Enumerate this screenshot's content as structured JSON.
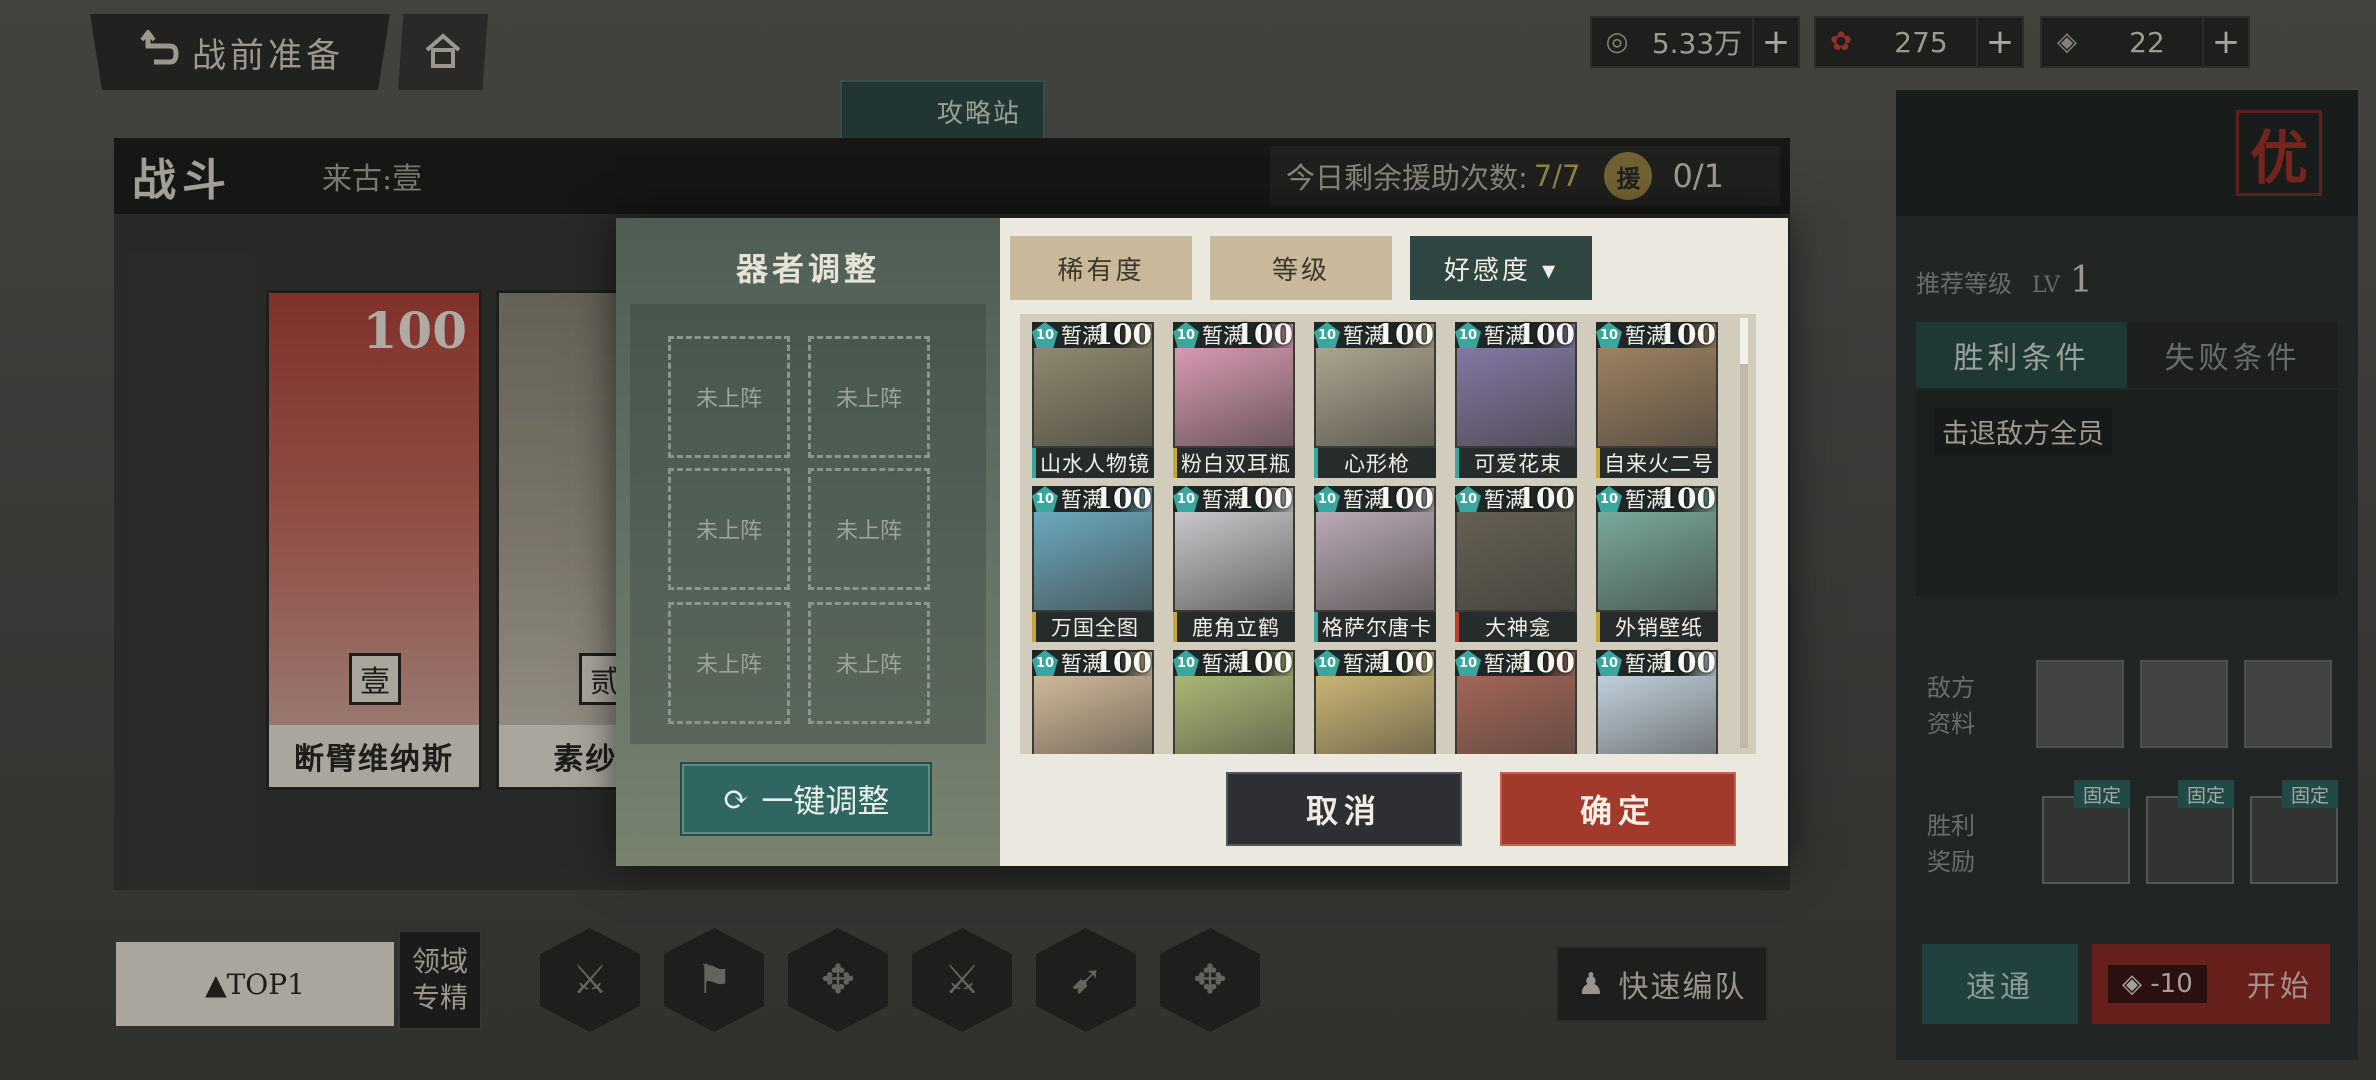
{
  "topbar": {
    "back_label": "战前准备",
    "resources": [
      {
        "icon": "coin-icon",
        "value": "5.33万"
      },
      {
        "icon": "gem-icon",
        "value": "275"
      },
      {
        "icon": "stamina-icon",
        "value": "22"
      }
    ],
    "guide_label": "攻略站"
  },
  "battle": {
    "title": "战斗",
    "stage": "来古:壹",
    "assist_label": "今日剩余援助次数:",
    "assist_count": "7/7",
    "assist_icon_char": "援",
    "assist_ratio": "0/1",
    "cards": [
      {
        "name": "断臂维纳斯",
        "level": "100",
        "seal": "壹"
      },
      {
        "name": "素纱...",
        "level": "",
        "seal": "贰"
      }
    ]
  },
  "modal": {
    "title": "器者调整",
    "empty_slot_label": "未上阵",
    "slots": [
      "未上阵",
      "未上阵",
      "未上阵",
      "未上阵",
      "未上阵",
      "未上阵"
    ],
    "adjust_button": "一键调整",
    "sort_buttons": [
      {
        "label": "稀有度",
        "active": false
      },
      {
        "label": "等级",
        "active": false
      },
      {
        "label": "好感度 ▾",
        "active": true
      }
    ],
    "items": [
      {
        "name": "山水人物镜",
        "star": "10",
        "status": "暂满",
        "level": "100"
      },
      {
        "name": "粉白双耳瓶",
        "star": "10",
        "status": "暂满",
        "level": "100"
      },
      {
        "name": "心形枪",
        "star": "10",
        "status": "暂满",
        "level": "100"
      },
      {
        "name": "可爱花束",
        "star": "10",
        "status": "暂满",
        "level": "100"
      },
      {
        "name": "自来火二号",
        "star": "10",
        "status": "暂满",
        "level": "100"
      },
      {
        "name": "万国全图",
        "star": "10",
        "status": "暂满",
        "level": "100"
      },
      {
        "name": "鹿角立鹤",
        "star": "10",
        "status": "暂满",
        "level": "100"
      },
      {
        "name": "格萨尔唐卡",
        "star": "10",
        "status": "暂满",
        "level": "100"
      },
      {
        "name": "大神龛",
        "star": "10",
        "status": "暂满",
        "level": "100"
      },
      {
        "name": "外销壁纸",
        "star": "10",
        "status": "暂满",
        "level": "100"
      },
      {
        "name": "",
        "star": "10",
        "status": "暂满",
        "level": "100"
      },
      {
        "name": "",
        "star": "10",
        "status": "暂满",
        "level": "100"
      },
      {
        "name": "",
        "star": "10",
        "status": "暂满",
        "level": "100"
      },
      {
        "name": "",
        "star": "10",
        "status": "暂满",
        "level": "100"
      },
      {
        "name": "",
        "star": "10",
        "status": "暂满",
        "level": "100"
      }
    ],
    "cancel_label": "取消",
    "confirm_label": "确定"
  },
  "right_panel": {
    "badge": "优",
    "recommend_label": "推荐等级",
    "recommend_lv": "LV",
    "recommend_value": "1",
    "tabs": [
      "胜利条件",
      "失败条件"
    ],
    "condition_text": "击退敌方全员",
    "enemy_label": "敌方资料",
    "reward_label": "胜利奖励",
    "reward_tag": "固定",
    "fast_label": "速通",
    "cost_label": "-10",
    "start_label": "开始"
  },
  "bottom": {
    "top_label": "▲TOP1",
    "domain_label": "领域专精",
    "quick_label": "快速编队"
  },
  "colors": {
    "accent_teal": "#2f6662",
    "accent_red": "#a23a2c",
    "star_teal": "#3aa6a0"
  }
}
